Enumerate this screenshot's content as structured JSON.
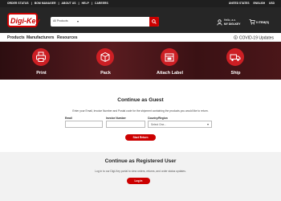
{
  "utility_bar": {
    "links": [
      "ORDER STATUS",
      "BOM MANAGER",
      "ABOUT US",
      "HELP",
      "CAREERS"
    ],
    "country": "UNITED STATES",
    "language": "ENGLISH",
    "currency": "USD"
  },
  "header": {
    "logo_text": "Digi-Key",
    "search_select": "All Products",
    "account_line1": "Hello, a.o.",
    "account_line2": "MY DIGI-KEY",
    "cart_label": "0 ITEM(S)"
  },
  "nav": {
    "items": [
      "Products",
      "Manufacturers",
      "Resources"
    ],
    "covid_label": "COVID-19 Updates"
  },
  "steps": [
    {
      "label": "Print",
      "icon": "printer-icon"
    },
    {
      "label": "Pack",
      "icon": "package-icon"
    },
    {
      "label": "Attach Label",
      "icon": "label-box-icon"
    },
    {
      "label": "Ship",
      "icon": "truck-icon"
    }
  ],
  "guest": {
    "title": "Continue as Guest",
    "description": "Enter your Email, Invoice Number and Postal code for the shipment containing the products you would like to return.",
    "email_label": "Email",
    "invoice_label": "Invoice Number",
    "country_label": "Country/Region",
    "country_placeholder": "Select One...",
    "submit_label": "Start Return"
  },
  "registered": {
    "title": "Continue as Registered User",
    "description": "Log in to our Digi-Key portal to view orders, returns, and order status updates.",
    "login_label": "Log in"
  },
  "colors": {
    "brand_red": "#cc0000",
    "header_dark": "#262626",
    "utility_dark": "#1f1f1f"
  }
}
